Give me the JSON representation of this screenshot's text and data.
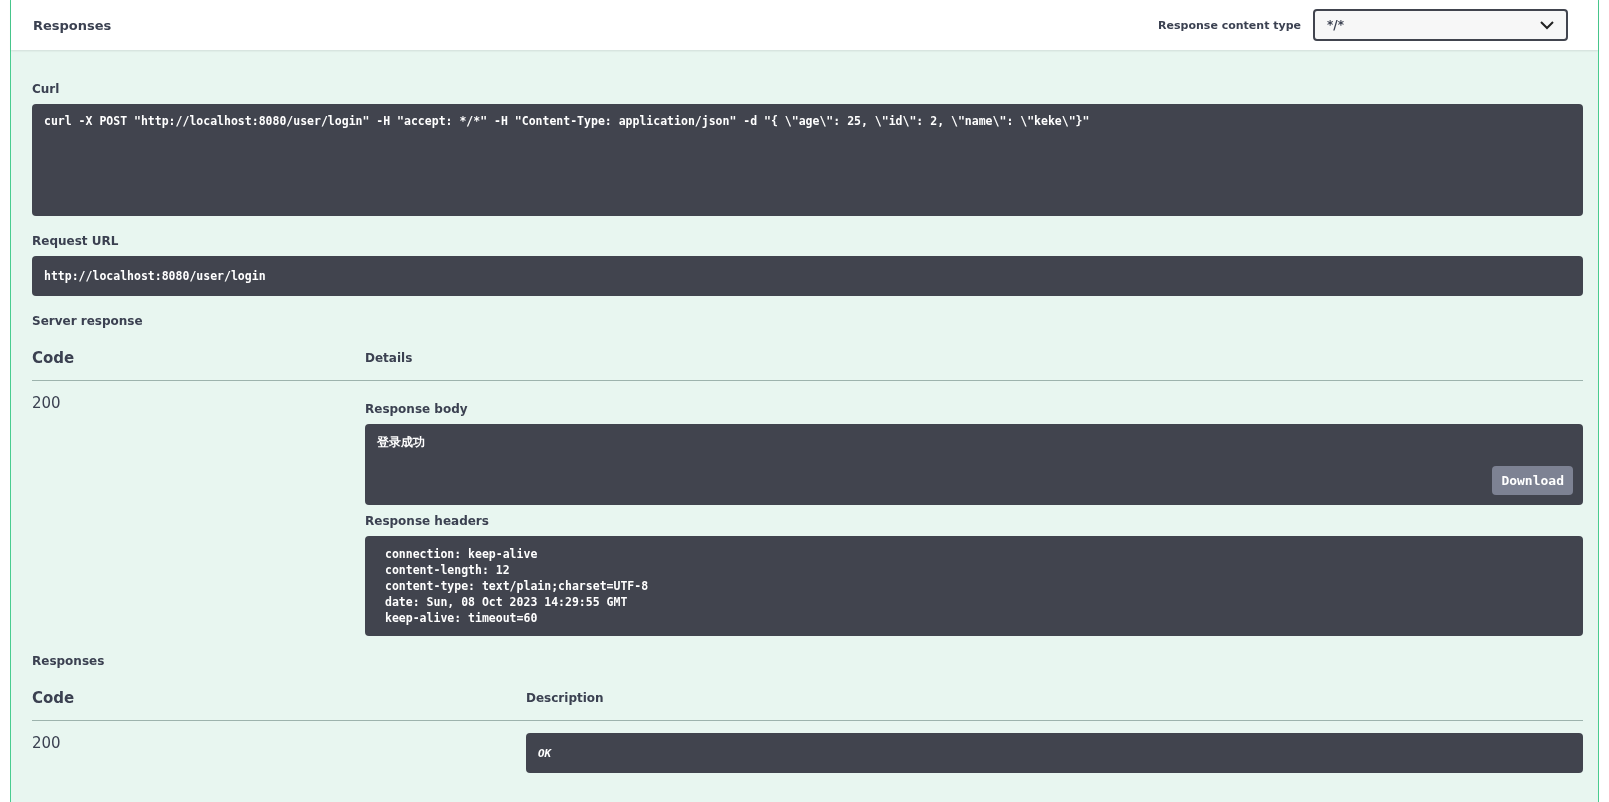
{
  "header": {
    "title": "Responses",
    "content_type_label": "Response content type",
    "content_type_value": "*/*"
  },
  "curl": {
    "label": "Curl",
    "command": "curl -X POST \"http://localhost:8080/user/login\" -H \"accept: */*\" -H \"Content-Type: application/json\" -d \"{ \\\"age\\\": 25, \\\"id\\\": 2, \\\"name\\\": \\\"keke\\\"}\""
  },
  "request_url": {
    "label": "Request URL",
    "value": "http://localhost:8080/user/login"
  },
  "server_response": {
    "label": "Server response",
    "columns": [
      "Code",
      "Details"
    ],
    "rows": [
      {
        "code": "200",
        "body_label": "Response body",
        "body": "登录成功",
        "download_button": "Download",
        "headers_label": "Response headers",
        "headers": [
          "connection: keep-alive",
          "content-length: 12",
          "content-type: text/plain;charset=UTF-8",
          "date: Sun, 08 Oct 2023 14:29:55 GMT",
          "keep-alive: timeout=60"
        ]
      }
    ]
  },
  "responses": {
    "label": "Responses",
    "columns": [
      "Code",
      "Description"
    ],
    "rows": [
      {
        "code": "200",
        "description": "OK"
      }
    ]
  }
}
